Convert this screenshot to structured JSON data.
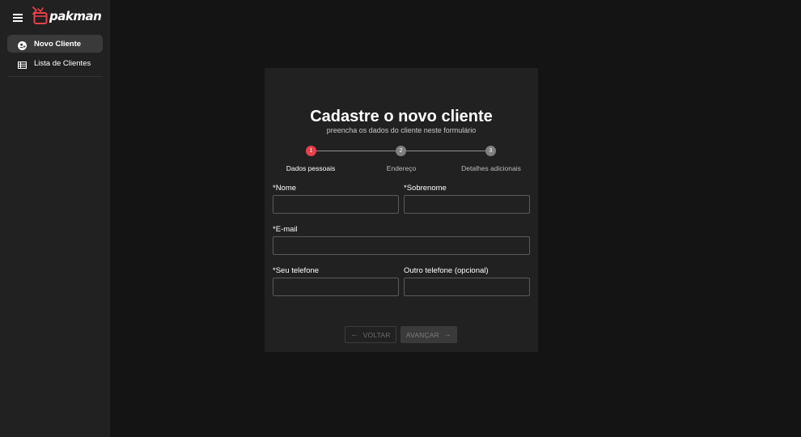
{
  "app": {
    "logo_text": "pakman",
    "brand_color": "#e8404a"
  },
  "sidebar": {
    "items": [
      {
        "label": "Novo Cliente",
        "icon": "add-user-icon",
        "active": true
      },
      {
        "label": "Lista de Clientes",
        "icon": "table-list-icon",
        "active": false
      }
    ]
  },
  "form": {
    "title": "Cadastre o novo cliente",
    "subtitle": "preencha os dados do cliente neste formulário",
    "steps": [
      {
        "number": "1",
        "label": "Dados pessoais",
        "active": true
      },
      {
        "number": "2",
        "label": "Endereço",
        "active": false
      },
      {
        "number": "3",
        "label": "Detalhes adicionais",
        "active": false
      }
    ],
    "fields": {
      "nome": {
        "label": "*Nome",
        "value": ""
      },
      "sobrenome": {
        "label": "*Sobrenome",
        "value": ""
      },
      "email": {
        "label": "*E-mail",
        "value": ""
      },
      "telefone": {
        "label": "*Seu telefone",
        "value": ""
      },
      "outro_telefone": {
        "label": "Outro telefone (opcional)",
        "value": ""
      }
    },
    "buttons": {
      "back_label": "VOLTAR",
      "next_label": "AVANÇAR"
    }
  }
}
